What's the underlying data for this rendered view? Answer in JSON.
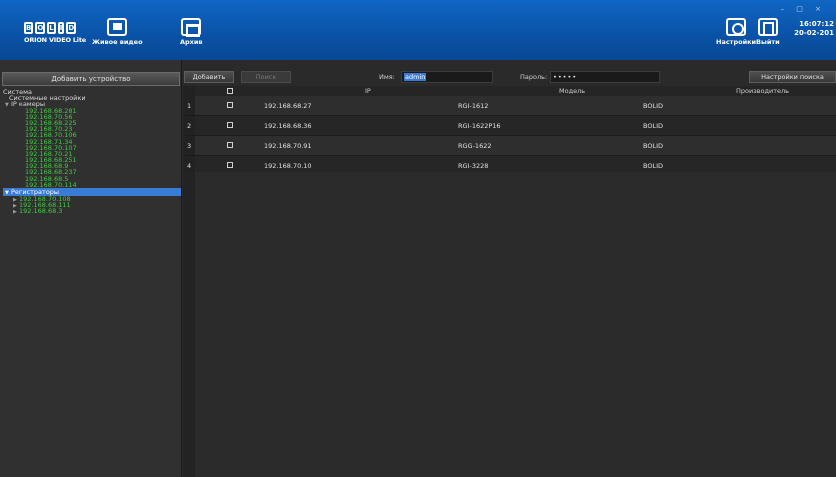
{
  "app": {
    "logo_letters": [
      "B",
      "O",
      "L",
      "I",
      "D"
    ],
    "logo_subtitle": "ORION VIDEO Lite"
  },
  "topbar": {
    "live_video_label": "Живое видео",
    "archive_label": "Архив",
    "settings_label": "Настройки",
    "exit_label": "Выйти",
    "window_controls": "– □ ×",
    "time": "16:07:12",
    "date": "20-02-201"
  },
  "sidebar": {
    "add_device_button": "Добавить устройство",
    "section_title": "Система",
    "system_settings": "Системные настройки",
    "ip_cameras_label": "IP камеры",
    "cameras": [
      "192.168.68.281",
      "192.168.70.56",
      "192.168.68.225",
      "192.168.70.23",
      "192.168.70.106",
      "192.168.71.34",
      "192.168.70.107",
      "192.168.70.21",
      "192.168.68.251",
      "192.168.68.9",
      "192.168.68.237",
      "192.168.68.5",
      "192.168.70.114"
    ],
    "registrators_label": "Регистраторы",
    "registrators": [
      "192.168.70.108",
      "192.168.68.111",
      "192.168.68.3"
    ]
  },
  "toolbar": {
    "add_button": "Добавить",
    "search_button": "Поиск",
    "name_label": "Имя:",
    "name_value": "admin",
    "password_label": "Пароль:",
    "password_value": "•••••",
    "search_settings_button": "Настройки поиска"
  },
  "table": {
    "headers": {
      "ip": "IP",
      "model": "Модель",
      "manufacturer": "Производитель"
    },
    "rows": [
      {
        "num": "1",
        "ip": "192.168.68.27",
        "model": "RGI-1612",
        "manufacturer": "BOLID"
      },
      {
        "num": "2",
        "ip": "192.168.68.36",
        "model": "RGI-1622P16",
        "manufacturer": "BOLID"
      },
      {
        "num": "3",
        "ip": "192.168.70.91",
        "model": "RGG-1622",
        "manufacturer": "BOLID"
      },
      {
        "num": "4",
        "ip": "192.168.70.10",
        "model": "RGI-3228",
        "manufacturer": "BOLID"
      }
    ]
  }
}
